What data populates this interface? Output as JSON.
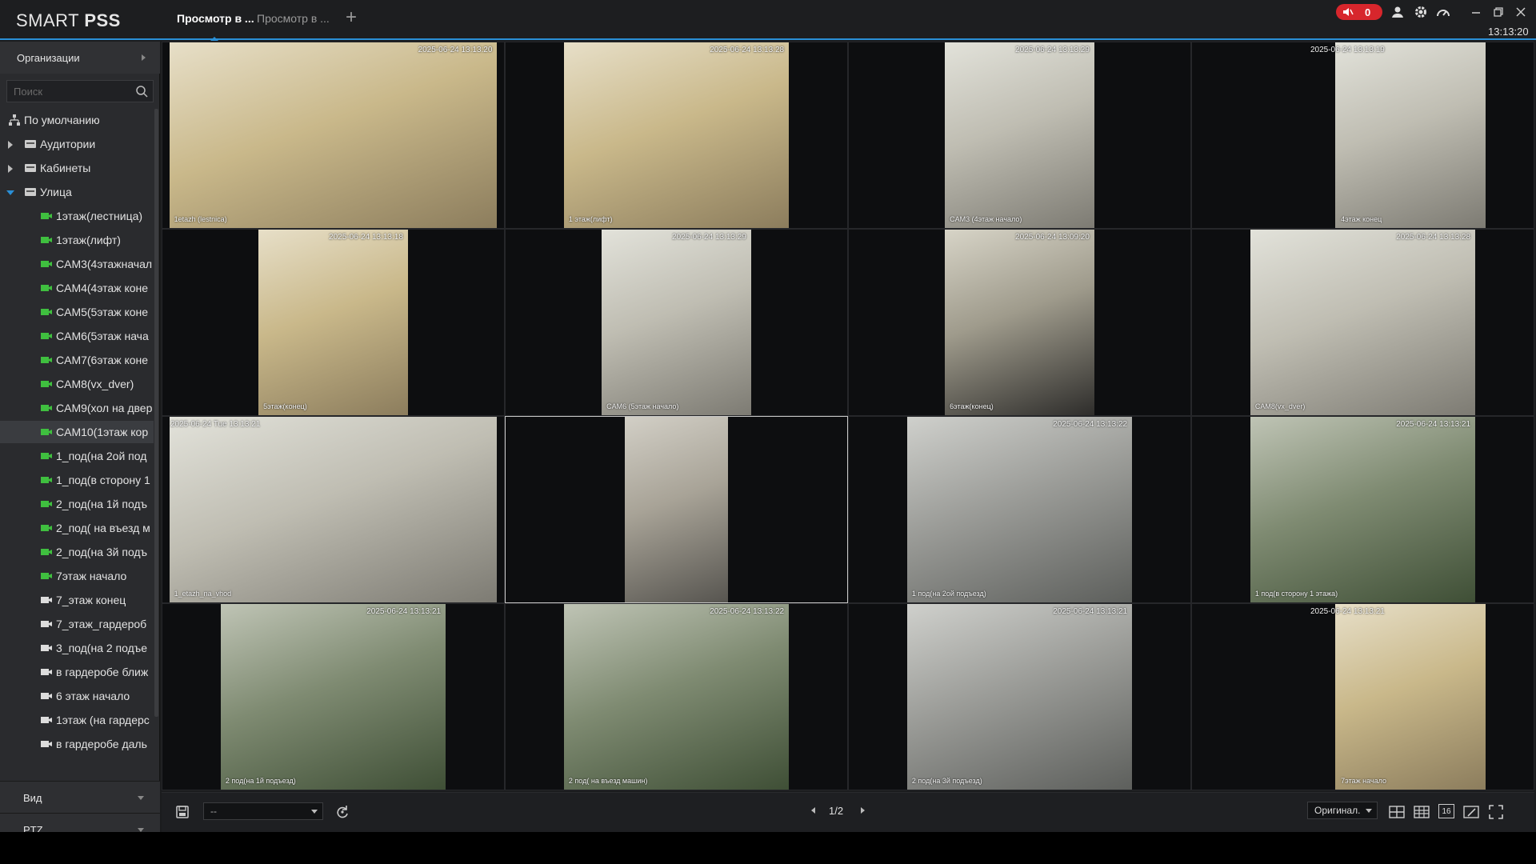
{
  "app": {
    "logo_light": "SMART ",
    "logo_bold": "PSS",
    "tabs": [
      "Просмотр в ...",
      "Просмотр в ..."
    ],
    "add_tab": "+",
    "alarm_count": "0",
    "clock": "13:13:20",
    "accent_color": "#2a8fd6",
    "alarm_color": "#d7262c"
  },
  "sidebar": {
    "org_header": "Организации",
    "search_placeholder": "Поиск",
    "root": "По умолчанию",
    "groups": [
      {
        "label": "Аудитории",
        "expanded": false
      },
      {
        "label": "Кабинеты",
        "expanded": false
      },
      {
        "label": "Улица",
        "expanded": true
      }
    ],
    "cameras": [
      {
        "label": "1этаж(лестница)",
        "online": true
      },
      {
        "label": "1этаж(лифт)",
        "online": true
      },
      {
        "label": "CAM3(4этажначал",
        "online": true
      },
      {
        "label": "CAM4(4этаж коне",
        "online": true
      },
      {
        "label": "CAM5(5этаж коне",
        "online": true
      },
      {
        "label": "CAM6(5этаж нача",
        "online": true
      },
      {
        "label": "CAM7(6этаж коне",
        "online": true
      },
      {
        "label": "CAM8(vx_dver)",
        "online": true
      },
      {
        "label": "CAM9(хол на двер",
        "online": true
      },
      {
        "label": "CAM10(1этаж кор",
        "online": true,
        "selected": true
      },
      {
        "label": "1_под(на 2ой под",
        "online": true
      },
      {
        "label": "1_под(в сторону 1",
        "online": true
      },
      {
        "label": "2_под(на 1й подъ",
        "online": true
      },
      {
        "label": "2_под( на въезд м",
        "online": true
      },
      {
        "label": "2_под(на 3й подъ",
        "online": true
      },
      {
        "label": "7этаж начало",
        "online": true
      },
      {
        "label": "7_этаж конец",
        "online": false
      },
      {
        "label": "7_этаж_гардероб",
        "online": false
      },
      {
        "label": "3_под(на 2 подъе",
        "online": false
      },
      {
        "label": "в гардеробе ближ",
        "online": false
      },
      {
        "label": "6 этаж начало",
        "online": false
      },
      {
        "label": "1этаж (на гардерс",
        "online": false
      },
      {
        "label": "в гардеробе даль",
        "online": false
      }
    ],
    "view_panel": "Вид",
    "ptz_panel": "PTZ"
  },
  "grid": {
    "cells": [
      {
        "timestamp": "2025-06-24 13:13:20",
        "caption": "1etazh (lestnica)",
        "scene": "indoor-warm"
      },
      {
        "timestamp": "2025-06-24 13:13:28",
        "caption": "1 этаж(лифт)",
        "scene": "indoor-warm"
      },
      {
        "timestamp": "2025-06-24 13:13:29",
        "caption": "CAM3 (4этаж начало)",
        "scene": "indoor"
      },
      {
        "timestamp": "2025-06-24 13:13:19",
        "caption": "4этаж конец",
        "scene": "indoor"
      },
      {
        "timestamp": "2025-06-24 13:13:18",
        "caption": "5этаж(конец)",
        "scene": "indoor-warm"
      },
      {
        "timestamp": "2025-06-24 13:13:29",
        "caption": "CAM6 (5этаж начало)",
        "scene": "indoor"
      },
      {
        "timestamp": "2025-06-24 13:09:20",
        "caption": "6этаж(конец)",
        "scene": "indoor-dark"
      },
      {
        "timestamp": "2025-06-24 13:13:28",
        "caption": "CAM8(vx_dver)",
        "scene": "indoor"
      },
      {
        "timestamp": "2025-06-24 Tue 13:13:21",
        "caption": "1_etazh_na_vhod",
        "scene": "indoor"
      },
      {
        "timestamp": "",
        "caption": "",
        "scene": "corridor"
      },
      {
        "timestamp": "2025-06-24 13:13:22",
        "caption": "1 под(на 2ой подъезд)",
        "scene": "street"
      },
      {
        "timestamp": "2025-06-24 13:13:21",
        "caption": "1 под(в сторону 1 этажа)",
        "scene": "street-green"
      },
      {
        "timestamp": "2025-06-24 13:13:21",
        "caption": "2 под(на 1й подъезд)",
        "scene": "street-green"
      },
      {
        "timestamp": "2025-06-24 13:13:22",
        "caption": "2 под( на въезд машин)",
        "scene": "street-green"
      },
      {
        "timestamp": "2025-06-24 13:13:21",
        "caption": "2 под(на 3й подъезд)",
        "scene": "street"
      },
      {
        "timestamp": "2025-06-24 13:13:21",
        "caption": "7этаж начало",
        "scene": "indoor-warm"
      }
    ]
  },
  "toolbar": {
    "layout_select": "--",
    "page": "1/2",
    "ratio": "Оригинал.",
    "split_16": "16"
  }
}
